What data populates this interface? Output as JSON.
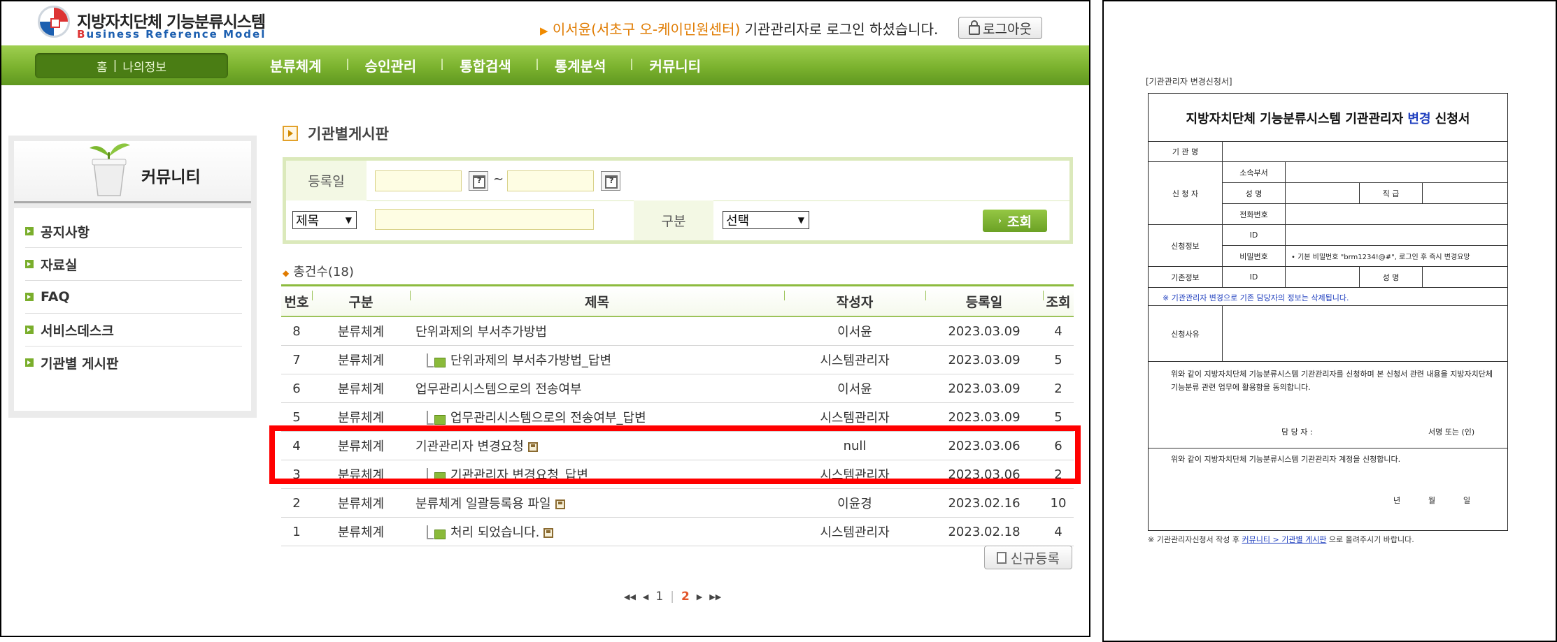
{
  "header": {
    "logo_title": "지방자치단체 기능분류시스템",
    "logo_sub_b": "B",
    "logo_sub_rest": "usiness Reference Model",
    "login_arrow": "▶",
    "login_user": "이서윤(서초구 오-케이민원센터)",
    "login_rest": " 기관관리자로 로그인 하셨습니다.",
    "logout_label": "로그아웃"
  },
  "nav": {
    "home": "홈",
    "sep": "|",
    "myinfo": "나의정보",
    "items": [
      "분류체계",
      "승인관리",
      "통합검색",
      "통계분석",
      "커뮤니티"
    ]
  },
  "sidebar": {
    "title": "커뮤니티",
    "items": [
      "공지사항",
      "자료실",
      "FAQ",
      "서비스데스크",
      "기관별 게시판"
    ]
  },
  "main": {
    "title": "기관별게시판",
    "search": {
      "date_label": "등록일",
      "tilde": "~",
      "field_select": "제목",
      "category_label": "구분",
      "category_select": "선택",
      "search_button": "조회"
    },
    "total": "총건수(18)",
    "columns": [
      "번호",
      "구분",
      "제목",
      "작성자",
      "등록일",
      "조회"
    ],
    "rows": [
      {
        "no": "8",
        "cat": "분류체계",
        "title": "단위과제의 부서추가방법",
        "reply": false,
        "file": false,
        "author": "이서윤",
        "date": "2023.03.09",
        "views": "4"
      },
      {
        "no": "7",
        "cat": "분류체계",
        "title": "단위과제의 부서추가방법_답변",
        "reply": true,
        "file": false,
        "author": "시스템관리자",
        "date": "2023.03.09",
        "views": "5"
      },
      {
        "no": "6",
        "cat": "분류체계",
        "title": "업무관리시스템으로의 전송여부",
        "reply": false,
        "file": false,
        "author": "이서윤",
        "date": "2023.03.09",
        "views": "2"
      },
      {
        "no": "5",
        "cat": "분류체계",
        "title": "업무관리시스템으로의 전송여부_답변",
        "reply": true,
        "file": false,
        "author": "시스템관리자",
        "date": "2023.03.09",
        "views": "5"
      },
      {
        "no": "4",
        "cat": "분류체계",
        "title": "기관관리자 변경요청",
        "reply": false,
        "file": true,
        "author": "null",
        "date": "2023.03.06",
        "views": "6"
      },
      {
        "no": "3",
        "cat": "분류체계",
        "title": "기관관리자 변경요청_답변",
        "reply": true,
        "file": false,
        "author": "시스템관리자",
        "date": "2023.03.06",
        "views": "2"
      },
      {
        "no": "2",
        "cat": "분류체계",
        "title": "분류체계 일괄등록용 파일",
        "reply": false,
        "file": true,
        "author": "이윤경",
        "date": "2023.02.16",
        "views": "10"
      },
      {
        "no": "1",
        "cat": "분류체계",
        "title": "처리 되었습니다.",
        "reply": true,
        "file": true,
        "author": "시스템관리자",
        "date": "2023.02.18",
        "views": "4"
      }
    ],
    "new_button": "신규등록",
    "pager": {
      "first": "◀◀",
      "prev": "◀",
      "page1": "1",
      "sep": "|",
      "page2": "2",
      "next": "▶",
      "last": "▶▶"
    }
  },
  "document": {
    "caption": "[기관관리자 변경신청서]",
    "title_a": "지방자치단체 기능분류시스템 기관관리자 ",
    "title_b": "변경",
    "title_c": " 신청서",
    "org": "기 관 명",
    "applicant": "신 청 자",
    "dept": "소속부서",
    "name": "성    명",
    "rank": "직    급",
    "phone": "전화번호",
    "apply_info": "신청정보",
    "id": "ID",
    "password": "비밀번호",
    "password_note": "• 기본 비밀번호 \"brm1234!@#\", 로그인 후 즉시 변경요망",
    "existing_info": "기존정보",
    "existing_id": "ID",
    "existing_name": "성 명",
    "warning": "※ 기관관리자 변경으로 기존 담당자의 정보는 삭제됩니다.",
    "reason": "신청사유",
    "agree_text": "위와 같이 지방자치단체 기능분류시스템 기관관리자를 신청하며 본 신청서 관련 내용을 지방자치단체 기능분류 관련 업무에 활용함을 동의합니다.",
    "officer": "담 당 자 :",
    "signature": "서명 또는 (인)",
    "apply_text": "위와 같이 지방자치단체 기능분류시스템 기관관리자 계정을 신청합니다.",
    "year": "년",
    "month": "월",
    "day": "일",
    "foot_a": "※ 기관관리자신청서 작성 후 ",
    "foot_link": "커뮤니티 > 기관별 게시판",
    "foot_b": " 으로 올려주시기 바랍니다."
  }
}
